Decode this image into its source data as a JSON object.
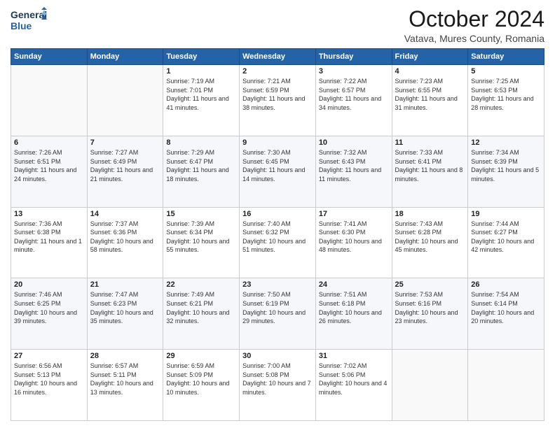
{
  "header": {
    "logo_line1": "General",
    "logo_line2": "Blue",
    "month": "October 2024",
    "location": "Vatava, Mures County, Romania"
  },
  "weekdays": [
    "Sunday",
    "Monday",
    "Tuesday",
    "Wednesday",
    "Thursday",
    "Friday",
    "Saturday"
  ],
  "weeks": [
    [
      {
        "day": "",
        "info": ""
      },
      {
        "day": "",
        "info": ""
      },
      {
        "day": "1",
        "info": "Sunrise: 7:19 AM\nSunset: 7:01 PM\nDaylight: 11 hours and 41 minutes."
      },
      {
        "day": "2",
        "info": "Sunrise: 7:21 AM\nSunset: 6:59 PM\nDaylight: 11 hours and 38 minutes."
      },
      {
        "day": "3",
        "info": "Sunrise: 7:22 AM\nSunset: 6:57 PM\nDaylight: 11 hours and 34 minutes."
      },
      {
        "day": "4",
        "info": "Sunrise: 7:23 AM\nSunset: 6:55 PM\nDaylight: 11 hours and 31 minutes."
      },
      {
        "day": "5",
        "info": "Sunrise: 7:25 AM\nSunset: 6:53 PM\nDaylight: 11 hours and 28 minutes."
      }
    ],
    [
      {
        "day": "6",
        "info": "Sunrise: 7:26 AM\nSunset: 6:51 PM\nDaylight: 11 hours and 24 minutes."
      },
      {
        "day": "7",
        "info": "Sunrise: 7:27 AM\nSunset: 6:49 PM\nDaylight: 11 hours and 21 minutes."
      },
      {
        "day": "8",
        "info": "Sunrise: 7:29 AM\nSunset: 6:47 PM\nDaylight: 11 hours and 18 minutes."
      },
      {
        "day": "9",
        "info": "Sunrise: 7:30 AM\nSunset: 6:45 PM\nDaylight: 11 hours and 14 minutes."
      },
      {
        "day": "10",
        "info": "Sunrise: 7:32 AM\nSunset: 6:43 PM\nDaylight: 11 hours and 11 minutes."
      },
      {
        "day": "11",
        "info": "Sunrise: 7:33 AM\nSunset: 6:41 PM\nDaylight: 11 hours and 8 minutes."
      },
      {
        "day": "12",
        "info": "Sunrise: 7:34 AM\nSunset: 6:39 PM\nDaylight: 11 hours and 5 minutes."
      }
    ],
    [
      {
        "day": "13",
        "info": "Sunrise: 7:36 AM\nSunset: 6:38 PM\nDaylight: 11 hours and 1 minute."
      },
      {
        "day": "14",
        "info": "Sunrise: 7:37 AM\nSunset: 6:36 PM\nDaylight: 10 hours and 58 minutes."
      },
      {
        "day": "15",
        "info": "Sunrise: 7:39 AM\nSunset: 6:34 PM\nDaylight: 10 hours and 55 minutes."
      },
      {
        "day": "16",
        "info": "Sunrise: 7:40 AM\nSunset: 6:32 PM\nDaylight: 10 hours and 51 minutes."
      },
      {
        "day": "17",
        "info": "Sunrise: 7:41 AM\nSunset: 6:30 PM\nDaylight: 10 hours and 48 minutes."
      },
      {
        "day": "18",
        "info": "Sunrise: 7:43 AM\nSunset: 6:28 PM\nDaylight: 10 hours and 45 minutes."
      },
      {
        "day": "19",
        "info": "Sunrise: 7:44 AM\nSunset: 6:27 PM\nDaylight: 10 hours and 42 minutes."
      }
    ],
    [
      {
        "day": "20",
        "info": "Sunrise: 7:46 AM\nSunset: 6:25 PM\nDaylight: 10 hours and 39 minutes."
      },
      {
        "day": "21",
        "info": "Sunrise: 7:47 AM\nSunset: 6:23 PM\nDaylight: 10 hours and 35 minutes."
      },
      {
        "day": "22",
        "info": "Sunrise: 7:49 AM\nSunset: 6:21 PM\nDaylight: 10 hours and 32 minutes."
      },
      {
        "day": "23",
        "info": "Sunrise: 7:50 AM\nSunset: 6:19 PM\nDaylight: 10 hours and 29 minutes."
      },
      {
        "day": "24",
        "info": "Sunrise: 7:51 AM\nSunset: 6:18 PM\nDaylight: 10 hours and 26 minutes."
      },
      {
        "day": "25",
        "info": "Sunrise: 7:53 AM\nSunset: 6:16 PM\nDaylight: 10 hours and 23 minutes."
      },
      {
        "day": "26",
        "info": "Sunrise: 7:54 AM\nSunset: 6:14 PM\nDaylight: 10 hours and 20 minutes."
      }
    ],
    [
      {
        "day": "27",
        "info": "Sunrise: 6:56 AM\nSunset: 5:13 PM\nDaylight: 10 hours and 16 minutes."
      },
      {
        "day": "28",
        "info": "Sunrise: 6:57 AM\nSunset: 5:11 PM\nDaylight: 10 hours and 13 minutes."
      },
      {
        "day": "29",
        "info": "Sunrise: 6:59 AM\nSunset: 5:09 PM\nDaylight: 10 hours and 10 minutes."
      },
      {
        "day": "30",
        "info": "Sunrise: 7:00 AM\nSunset: 5:08 PM\nDaylight: 10 hours and 7 minutes."
      },
      {
        "day": "31",
        "info": "Sunrise: 7:02 AM\nSunset: 5:06 PM\nDaylight: 10 hours and 4 minutes."
      },
      {
        "day": "",
        "info": ""
      },
      {
        "day": "",
        "info": ""
      }
    ]
  ]
}
